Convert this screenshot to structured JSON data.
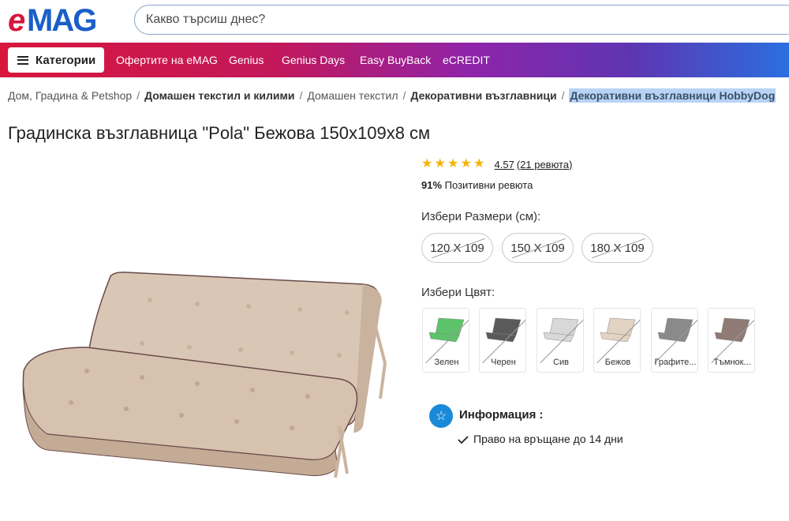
{
  "header": {
    "logo_text": "eMAG",
    "search_placeholder": "Какво търсиш днес?"
  },
  "nav": {
    "categories_label": "Категории",
    "links": [
      "Офертите на eMAG",
      "Genius",
      "Genius Days",
      "Easy BuyBack",
      "eCREDIT"
    ]
  },
  "breadcrumb": {
    "items": [
      "Дом, Градина & Petshop",
      "Домашен текстил и килими",
      "Домашен текстил",
      "Декоративни възглавници",
      "Декоративни възглавници HobbyDog"
    ],
    "separator": "/"
  },
  "product": {
    "title": "Градинска възглавница \"Pola\" Бежова 150x109x8 см",
    "rating_value": "4.57",
    "rating_count": "(21 ревюта)",
    "rating_stars": 4.57,
    "positive_percent": "91%",
    "positive_label": "Позитивни ревюта",
    "size_label": "Избери Размери (см):",
    "sizes": [
      "120 X 109",
      "150 X 109",
      "180 X 109"
    ],
    "color_label": "Избери Цвят:",
    "colors": [
      {
        "label": "Зелен",
        "hex": "#5cc36a"
      },
      {
        "label": "Черен",
        "hex": "#5a5a5a"
      },
      {
        "label": "Сив",
        "hex": "#d8d8d8"
      },
      {
        "label": "Бежов",
        "hex": "#e2d3c2"
      },
      {
        "label": "Графите...",
        "hex": "#8a8a8a"
      },
      {
        "label": "Тъмнок...",
        "hex": "#8f7a74"
      }
    ],
    "info_title": "Информация :",
    "info_items": [
      "Право на връщане до 14 дни"
    ]
  },
  "colors": {
    "brand_red": "#d8163c",
    "info_blue": "#1a8ad8",
    "star": "#f5b301"
  }
}
